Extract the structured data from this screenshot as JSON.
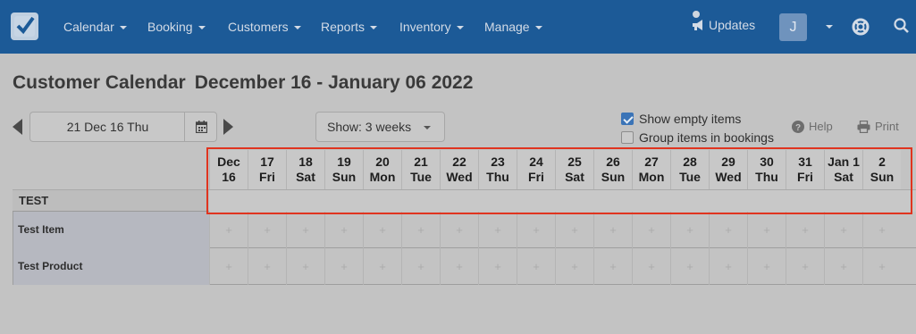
{
  "nav": {
    "logo_icon": "checkbox-logo-icon",
    "items": [
      {
        "label": "Calendar"
      },
      {
        "label": "Booking"
      },
      {
        "label": "Customers"
      },
      {
        "label": "Reports"
      },
      {
        "label": "Inventory"
      },
      {
        "label": "Manage"
      }
    ],
    "updates_label": "Updates",
    "avatar_initial": "J"
  },
  "page": {
    "title": "Customer Calendar",
    "range": "December 16 - January 06 2022"
  },
  "toolbar": {
    "date_value": "21 Dec 16 Thu",
    "show_label": "Show: 3 weeks",
    "show_empty_label": "Show empty items",
    "show_empty_checked": true,
    "group_items_label": "Group items in bookings",
    "group_items_checked": false,
    "help_label": "Help",
    "print_label": "Print"
  },
  "calendar": {
    "days": [
      {
        "top": "Dec",
        "bottom": "16"
      },
      {
        "top": "17",
        "bottom": "Fri"
      },
      {
        "top": "18",
        "bottom": "Sat"
      },
      {
        "top": "19",
        "bottom": "Sun"
      },
      {
        "top": "20",
        "bottom": "Mon"
      },
      {
        "top": "21",
        "bottom": "Tue"
      },
      {
        "top": "22",
        "bottom": "Wed"
      },
      {
        "top": "23",
        "bottom": "Thu"
      },
      {
        "top": "24",
        "bottom": "Fri"
      },
      {
        "top": "25",
        "bottom": "Sat"
      },
      {
        "top": "26",
        "bottom": "Sun"
      },
      {
        "top": "27",
        "bottom": "Mon"
      },
      {
        "top": "28",
        "bottom": "Tue"
      },
      {
        "top": "29",
        "bottom": "Wed"
      },
      {
        "top": "30",
        "bottom": "Thu"
      },
      {
        "top": "31",
        "bottom": "Fri"
      },
      {
        "top": "Jan 1",
        "bottom": "Sat"
      },
      {
        "top": "2",
        "bottom": "Sun"
      }
    ],
    "group": "TEST",
    "items": [
      {
        "label": "Test Item"
      },
      {
        "label": "Test Product"
      }
    ],
    "cell_symbol": "+"
  },
  "colors": {
    "nav_bg": "#1c5a97",
    "highlight": "#e0341f",
    "checkbox_on": "#3b74b7"
  }
}
